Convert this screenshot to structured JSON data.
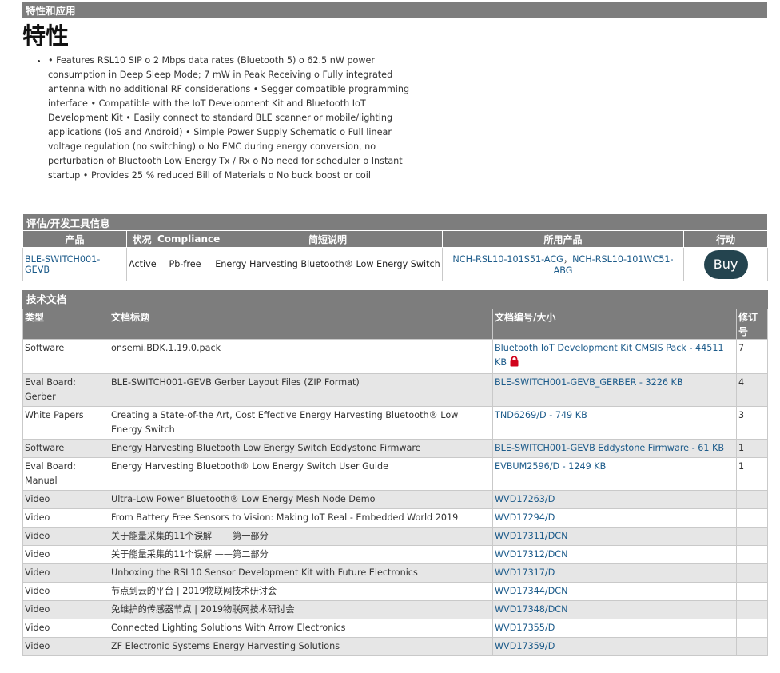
{
  "features_section": {
    "header": "特性和应用",
    "title": "特性",
    "text": "• Features RSL10 SIP o 2 Mbps data rates (Bluetooth 5) o 62.5 nW power consumption in Deep Sleep Mode; 7 mW in Peak Receiving o Fully integrated antenna with no additional RF considerations • Segger compatible programming interface • Compatible with the IoT Development Kit and Bluetooth IoT Development Kit • Easily connect to standard BLE scanner or mobile/lighting applications (IoS and Android) • Simple Power Supply Schematic o Full linear voltage regulation (no switching) o No EMC during energy conversion, no perturbation of Bluetooth Low Energy Tx / Rx o No need for scheduler o Instant startup • Provides 25 % reduced Bill of Materials o No buck boost or coil"
  },
  "tools_section": {
    "header": "评估/开发工具信息",
    "columns": [
      "产品",
      "状况",
      "Compliance",
      "简短说明",
      "所用产品",
      "行动"
    ],
    "row": {
      "product": "BLE-SWITCH001-GEVB",
      "status": "Active",
      "compliance": "Pb-free",
      "description": "Energy Harvesting Bluetooth® Low Energy Switch",
      "used_product_1": "NCH-RSL10-101S51-ACG",
      "separator": "，",
      "used_product_2": "NCH-RSL10-101WC51-ABG",
      "action": "Buy"
    }
  },
  "docs_section": {
    "header": "技术文档",
    "columns": {
      "type": "类型",
      "title": "文档标题",
      "number": "文档编号/大小",
      "rev": "修订号"
    },
    "rows": [
      {
        "type": "Software",
        "title": "onsemi.BDK.1.19.0.pack",
        "number": "Bluetooth IoT Development Kit CMSIS Pack - 44511 KB",
        "rev": "7",
        "locked": true
      },
      {
        "type": "Eval Board: Gerber",
        "title": "BLE-SWITCH001-GEVB Gerber Layout Files (ZIP Format)",
        "number": "BLE-SWITCH001-GEVB_GERBER - 3226 KB",
        "rev": "4"
      },
      {
        "type": "White Papers",
        "title": "Creating a State-of-the Art, Cost Effective Energy Harvesting Bluetooth® Low Energy Switch",
        "number": "TND6269/D - 749 KB",
        "rev": "3"
      },
      {
        "type": "Software",
        "title": "Energy Harvesting Bluetooth Low Energy Switch Eddystone Firmware",
        "number": "BLE-SWITCH001-GEVB Eddystone Firmware - 61 KB",
        "rev": "1"
      },
      {
        "type": "Eval Board: Manual",
        "title": "Energy Harvesting Bluetooth® Low Energy Switch User Guide",
        "number": "EVBUM2596/D - 1249 KB",
        "rev": "1"
      },
      {
        "type": "Video",
        "title": "Ultra-Low Power Bluetooth® Low Energy Mesh Node Demo",
        "number": "WVD17263/D",
        "rev": ""
      },
      {
        "type": "Video",
        "title": "From Battery Free Sensors to Vision: Making IoT Real - Embedded World 2019",
        "number": "WVD17294/D",
        "rev": ""
      },
      {
        "type": "Video",
        "title": "关于能量采集的11个误解 ——第一部分",
        "number": "WVD17311/DCN",
        "rev": ""
      },
      {
        "type": "Video",
        "title": "关于能量采集的11个误解 ——第二部分",
        "number": "WVD17312/DCN",
        "rev": ""
      },
      {
        "type": "Video",
        "title": "Unboxing the RSL10 Sensor Development Kit with Future Electronics",
        "number": "WVD17317/D",
        "rev": ""
      },
      {
        "type": "Video",
        "title": "节点到云的平台 | 2019物联网技术研讨会",
        "number": "WVD17344/DCN",
        "rev": ""
      },
      {
        "type": "Video",
        "title": "免维护的传感器节点 | 2019物联网技术研讨会",
        "number": "WVD17348/DCN",
        "rev": ""
      },
      {
        "type": "Video",
        "title": "Connected Lighting Solutions With Arrow Electronics",
        "number": "WVD17355/D",
        "rev": ""
      },
      {
        "type": "Video",
        "title": "ZF Electronic Systems Energy Harvesting Solutions",
        "number": "WVD17359/D",
        "rev": ""
      }
    ]
  },
  "colors": {
    "header_bg": "#7d7d7d",
    "link": "#1c5b8a",
    "buy_bg": "#24444f",
    "stripe": "#e6e6e6",
    "lock": "#d0021b"
  }
}
